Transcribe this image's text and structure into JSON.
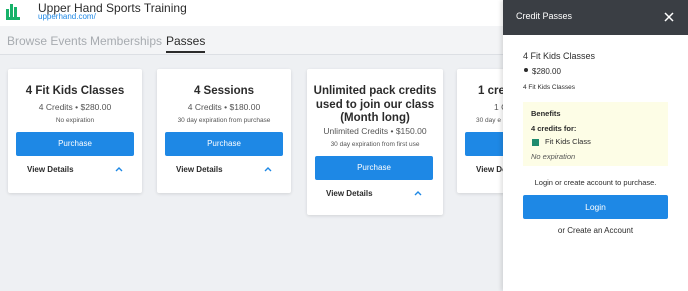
{
  "header": {
    "brand_title": "Upper Hand Sports Training",
    "brand_url": "upperhand.com/",
    "logo_color": "#17b26a"
  },
  "tabs": [
    {
      "label": "Browse Events",
      "active": false
    },
    {
      "label": "Memberships",
      "active": false
    },
    {
      "label": "Passes",
      "active": true
    }
  ],
  "cards": [
    {
      "title": "4 Fit Kids Classes",
      "price_line": "4 Credits • $280.00",
      "expiration": "No expiration",
      "purchase_label": "Purchase",
      "details_label": "View Details"
    },
    {
      "title": "4 Sessions",
      "price_line": "4 Credits • $180.00",
      "expiration": "30 day expiration from purchase",
      "purchase_label": "Purchase",
      "details_label": "View Details"
    },
    {
      "title": "Unlimited pack credits used to join our class (Month long)",
      "price_line": "Unlimited Credits • $150.00",
      "expiration": "30 day expiration from first use",
      "purchase_label": "Purchase",
      "details_label": "View Details"
    },
    {
      "title": "1 cred",
      "price_line": "1 C",
      "expiration": "30 day e",
      "purchase_label": "Purchase",
      "details_label": "View Deta"
    }
  ],
  "drawer": {
    "title": "Credit Passes",
    "pass_name": "4 Fit Kids Classes",
    "price": "$280.00",
    "pass_subname": "4 Fit Kids Classes",
    "benefits": {
      "heading": "Benefits",
      "credits_for": "4 credits for:",
      "class_name": "Fit Kids Class",
      "class_color": "#1f8b6e",
      "expiration": "No expiration"
    },
    "prompt": "Login or create account to purchase.",
    "login_label": "Login",
    "create_account_label": "or Create an Account"
  },
  "colors": {
    "accent": "#1e88e5",
    "drawer_header": "#3a3e44",
    "benefits_bg": "#fdfde6"
  }
}
